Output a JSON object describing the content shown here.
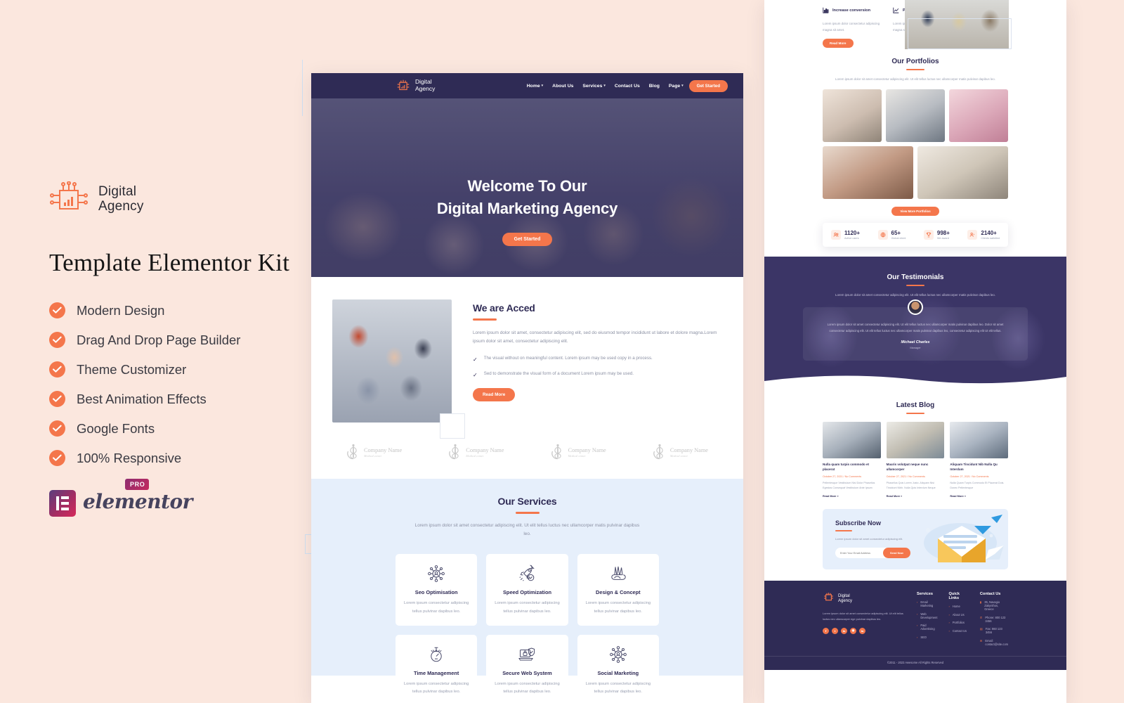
{
  "promo": {
    "brand": {
      "line1": "Digital",
      "line2": "Agency",
      "icon": "digital-agency-logo-icon"
    },
    "kit_title": "Template Elementor Kit",
    "features": [
      "Modern Design",
      "Drag And Drop Page Builder",
      "Theme Customizer",
      "Best Animation Effects",
      "Google Fonts",
      "100% Responsive"
    ],
    "elementor": {
      "word": "elementor",
      "badge": "PRO"
    },
    "colors": {
      "background": "#fbe7de",
      "accent": "#f4764b",
      "navy": "#2f2b55"
    }
  },
  "desktop": {
    "nav": {
      "brand_line1": "Digital",
      "brand_line2": "Agency",
      "items": [
        {
          "label": "Home",
          "has_caret": true
        },
        {
          "label": "About Us",
          "has_caret": false
        },
        {
          "label": "Services",
          "has_caret": true
        },
        {
          "label": "Contact Us",
          "has_caret": false
        },
        {
          "label": "Blog",
          "has_caret": false
        },
        {
          "label": "Page",
          "has_caret": true
        }
      ],
      "cta": "Get Started"
    },
    "hero": {
      "line1": "Welcome To Our",
      "line2": "Digital Marketing Agency",
      "cta": "Get Started"
    },
    "about": {
      "title": "We are Acced",
      "paragraph": "Lorem ipsum dolor sit amet, consectetur adipiscing elit, sed do eiusmod tempor incididunt ut labore et dolore magna.Lorem ipsum dolor sit amet, consectetur adipiscing elit.",
      "checks": [
        "The visual without on meaningful content. Lorem ipsum may be used copy in a process.",
        "Sed to demonstrate the visual form of a document Lorem ipsum may be used."
      ],
      "cta": "Read More"
    },
    "clients": [
      {
        "name": "Company Name",
        "sub": "Medical center"
      },
      {
        "name": "Company Name",
        "sub": "Medical center"
      },
      {
        "name": "Company Name",
        "sub": "Medical center"
      },
      {
        "name": "Company Name",
        "sub": "Medical center"
      }
    ],
    "services": {
      "title": "Our Services",
      "subtitle": "Lorem ipsum dolor sit amet consectetur adipiscing elit. Ut elit tellus luctus nec ullamcorper matis pulvinar dapibus leo.",
      "cards": [
        {
          "title": "Seo Optimisation",
          "desc": "Lorem ipsum consectetur adipiscing tellus pulvinar dapibus leo.",
          "icon": "network-user-icon"
        },
        {
          "title": "Speed Optimization",
          "desc": "Lorem ipsum consectetur adipiscing tellus pulvinar dapibus leo.",
          "icon": "rocket-check-icon"
        },
        {
          "title": "Design & Concept",
          "desc": "Lorem ipsum consectetur adipiscing tellus pulvinar dapibus leo.",
          "icon": "design-tools-icon"
        },
        {
          "title": "Time Management",
          "desc": "Lorem ipsum consectetur adipiscing tellus pulvinar dapibus leo.",
          "icon": "stopwatch-icon"
        },
        {
          "title": "Secure Web System",
          "desc": "Lorem ipsum consectetur adipiscing tellus pulvinar dapibus leo.",
          "icon": "laptop-lock-icon"
        },
        {
          "title": "Social Marketing",
          "desc": "Lorem ipsum consectetur adipiscing tellus pulvinar dapibus leo.",
          "icon": "network-user-icon"
        }
      ]
    }
  },
  "longpage": {
    "features": [
      {
        "title": "Increase conversion",
        "body": "Lorem ipsum dolor consectetur adipiscing magna sit amet.",
        "icon": "bar-chart-icon"
      },
      {
        "title": "Product analytics",
        "body": "Lorem ipsum dolor consectetur adipiscing magna sit amet.",
        "icon": "line-chart-icon"
      }
    ],
    "features_cta": "Read More",
    "portfolio": {
      "title": "Our Portfolios",
      "subtitle": "Lorem ipsum dolor sit amet consectetur adipiscing elit. Ut elit tellus luctus nec ullamcorper matis pulvinar dapibus leo.",
      "cta": "View More Portfolios"
    },
    "stats": [
      {
        "value": "1120+",
        "label": "Active users",
        "icon": "users-icon"
      },
      {
        "value": "65+",
        "label": "Global client",
        "icon": "globe-icon"
      },
      {
        "value": "998+",
        "label": "We award",
        "icon": "trophy-icon"
      },
      {
        "value": "2140+",
        "label": "Clients satisfied",
        "icon": "smile-icon"
      }
    ],
    "testimonials": {
      "title": "Our Testimonials",
      "subtitle": "Lorem ipsum dolor sit amet consectetur adipiscing elit. Ut elit tellus luctus nec ullamcorper matis pulvinar dapibus leo.",
      "quote": "Lorem ipsum dolor sit amet consectetur adipiscing elit. Ut elit tellus luctus nec ullamcorper matis pulvinar dapibus leo. Dolor sit amet consectetur adipiscing elit. Ut elit tellus luctus nec ullamcorper matis pulvinar dapibus leo, consectetur adipiscing elit Ut elit tellus.",
      "name": "Michael Charles",
      "role": "Manager"
    },
    "blog": {
      "title": "Latest Blog",
      "posts": [
        {
          "title": "Nulla quam turpis commodo et placerat",
          "meta": "October 27, 2021 / No Comments",
          "excerpt": "Pellentesque Vestibulum Nisi Dolor Phasellus Egestas Consequat Vestibulum Ante Ipsum",
          "more": "Read More »",
          "image": "blog-image-office-meeting"
        },
        {
          "title": "Mauris volutpat neque nunc ullamcorper",
          "meta": "October 27, 2021 / No Comments",
          "excerpt": "Phasellus Quis Lorem Justo. Aliquam Nisi Tincidunt Nibh. Nulla Quis Interdum Neque",
          "more": "Read More »",
          "image": "blog-image-team-laptop"
        },
        {
          "title": "Aliquam Tincidunt Nib Nulla Qu Interdum",
          "meta": "October 27, 2021 / No Comments",
          "excerpt": "Nulla Quam Turpis Commodo Et Placerat Duis. Donec Pellentesque",
          "more": "Read More »",
          "image": "blog-image-coworking"
        }
      ]
    },
    "subscribe": {
      "title": "Subscribe Now",
      "text": "Lorem ipsum dolor sit amet consectetur adipiscing elit.",
      "placeholder": "Enter Your Email Address",
      "cta": "Send Now",
      "art": "email-envelope-illustration"
    },
    "footer": {
      "brand_line1": "Digital",
      "brand_line2": "Agency",
      "about": "Lorem ipsum dolor sit amet consectetur adipiscing elit. Ut elit tellus luctus nec ullamcorper ege pulvinar dapibus leo.",
      "social": [
        {
          "glyph": "f",
          "name": "facebook-icon"
        },
        {
          "glyph": "t",
          "name": "twitter-icon"
        },
        {
          "glyph": "in",
          "name": "linkedin-icon"
        },
        {
          "glyph": "◉",
          "name": "instagram-icon"
        },
        {
          "glyph": "in",
          "name": "pinterest-icon"
        }
      ],
      "columns": [
        {
          "heading": "Services",
          "links": [
            "Email Marketing",
            "Web Development",
            "Paid Advertising",
            "SEO"
          ]
        },
        {
          "heading": "Quick Links",
          "links": [
            "Home",
            "About Us",
            "Portfolios",
            "Contact Us"
          ]
        }
      ],
      "contact": {
        "heading": "Contact Us",
        "items": [
          {
            "icon": "map-pin-icon",
            "text": "35, Navagio Zakynthos, Greece"
          },
          {
            "icon": "phone-icon",
            "text": "Phone: 800 123 3456"
          },
          {
            "icon": "fax-icon",
            "text": "Fax: 860 123 3456"
          },
          {
            "icon": "mail-icon",
            "text": "Email: contact@site.com"
          }
        ]
      },
      "copyright": "©2011 - 2023 Awesome All Rights Reserved"
    }
  }
}
